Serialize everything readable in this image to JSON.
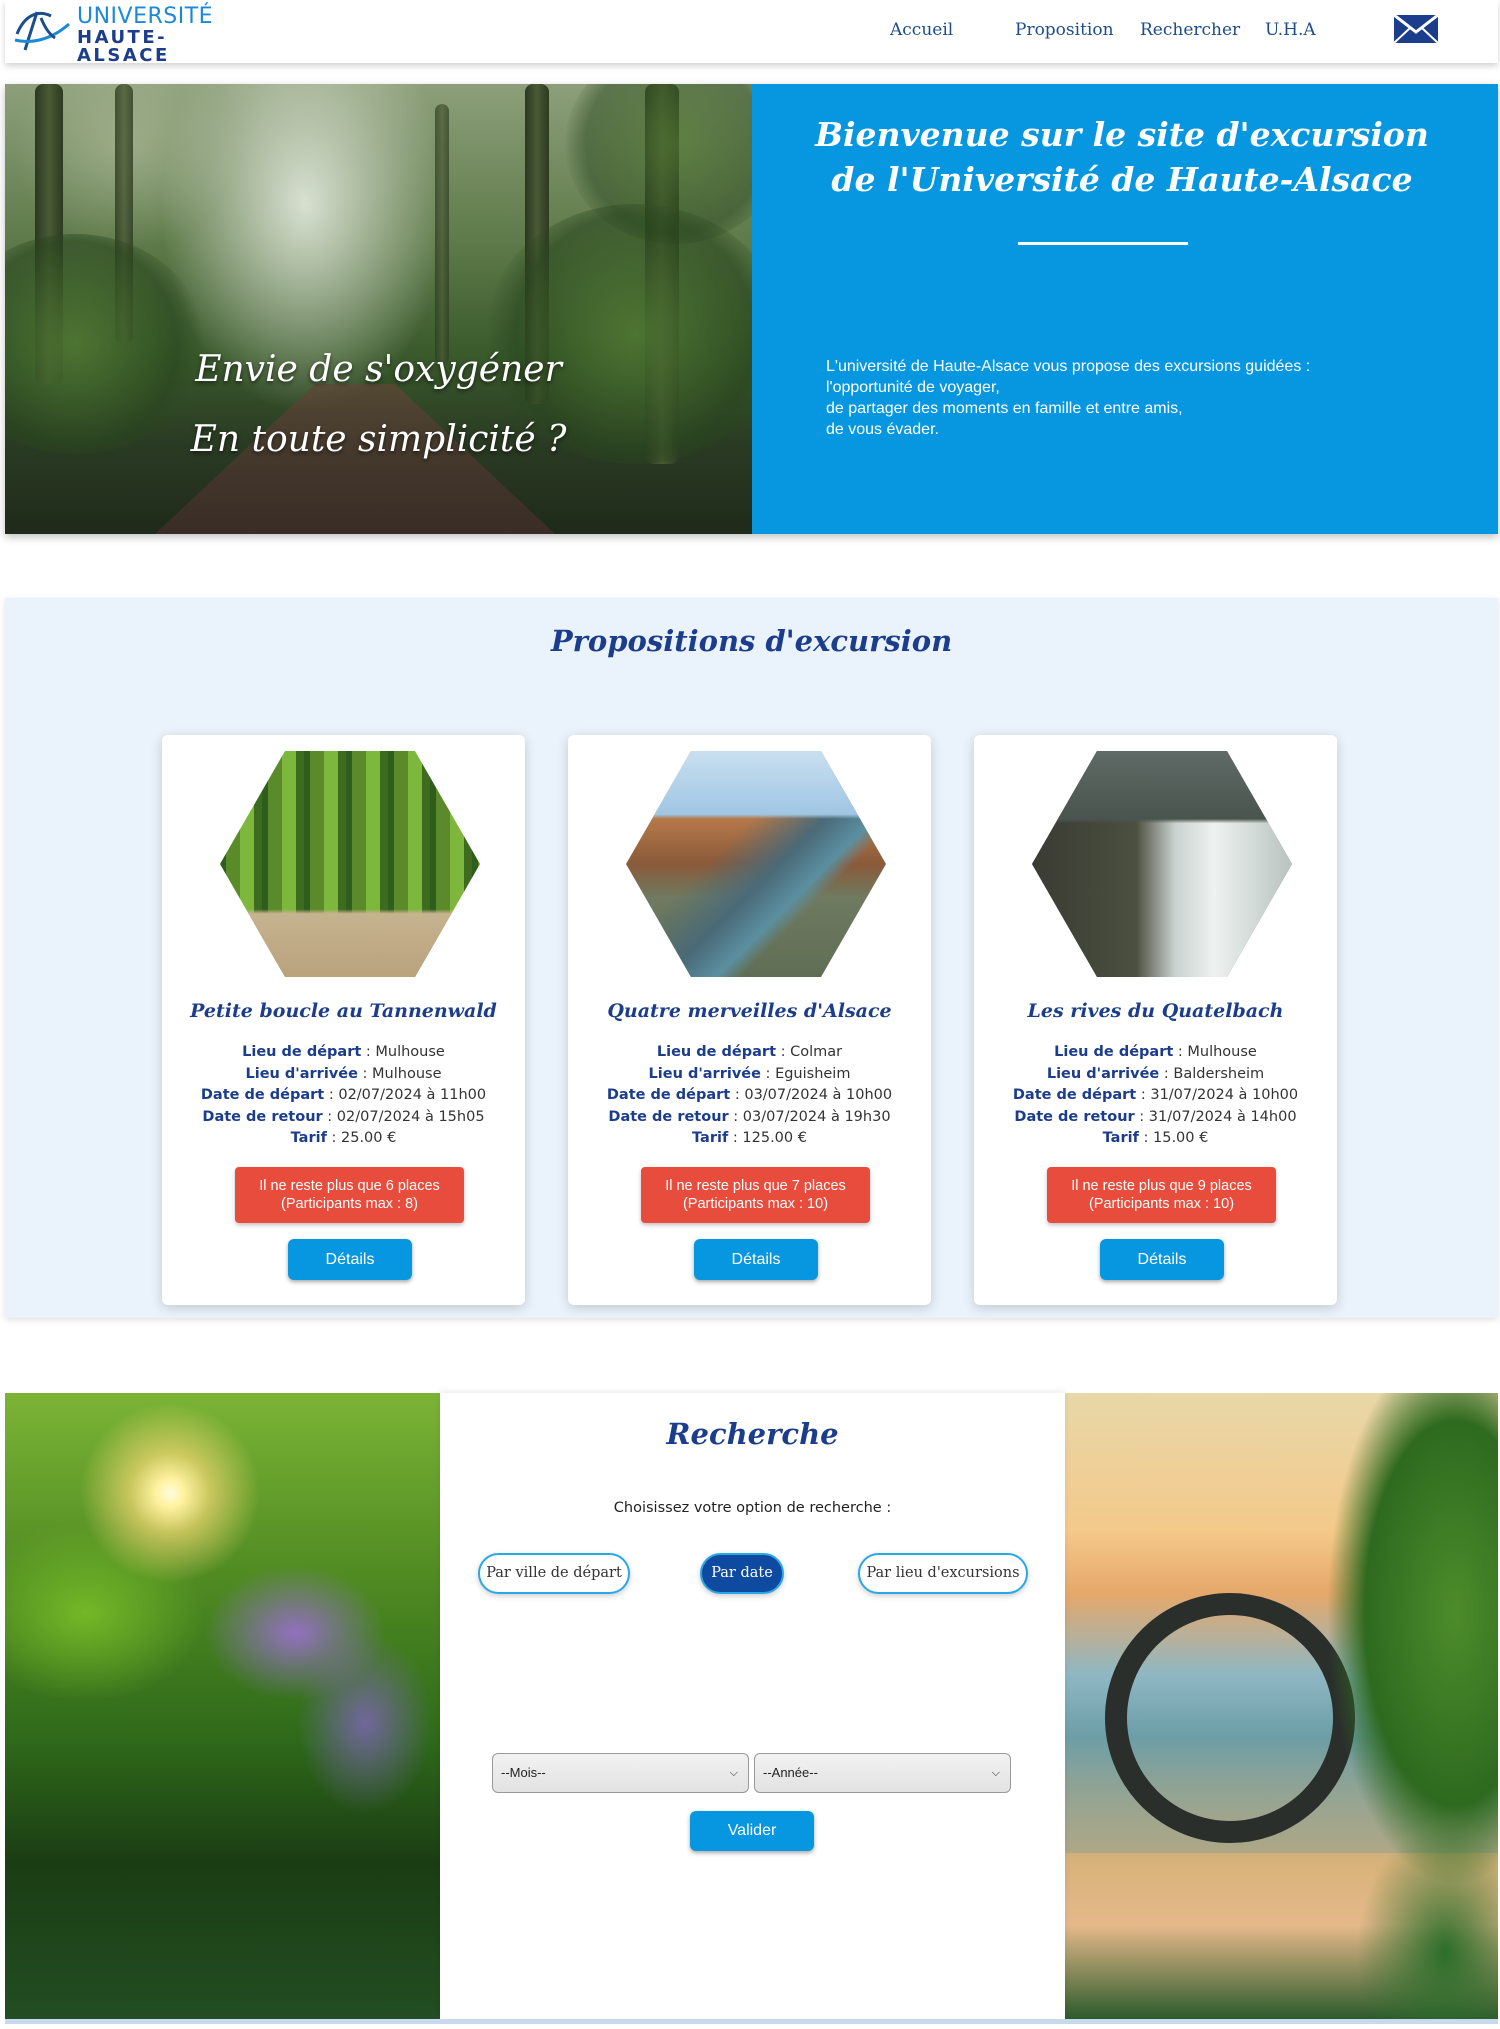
{
  "nav": {
    "logo_line1": "UNIVERSITÉ",
    "logo_line2": "HAUTE-ALSACE",
    "links": [
      "Accueil",
      "Proposition",
      "Rechercher",
      "U.H.A"
    ]
  },
  "hero": {
    "quote_line1": "Envie de s'oxygéner",
    "quote_line2": "En toute simplicité ?",
    "title": "Bienvenue sur le site d'excursion de l'Université de Haute-Alsace",
    "description": [
      "L'université de Haute-Alsace vous propose des excursions guidées :",
      "l'opportunité de voyager,",
      "de partager des moments en famille et entre amis,",
      "de vous évader."
    ]
  },
  "propositions": {
    "title": "Propositions d'excursion",
    "labels": {
      "depart": "Lieu de départ",
      "arrivee": "Lieu d'arrivée",
      "date_depart": "Date de départ",
      "date_retour": "Date de retour",
      "tarif": "Tarif"
    },
    "details_label": "Détails",
    "cards": [
      {
        "title": "Petite boucle au Tannenwald",
        "depart": "Mulhouse",
        "arrivee": "Mulhouse",
        "date_depart": "02/07/2024 à 11h00",
        "date_retour": "02/07/2024 à 15h05",
        "tarif": "25.00 €",
        "places_line1": "Il ne reste plus que 6 places",
        "places_line2": "(Participants max : 8)"
      },
      {
        "title": "Quatre merveilles d'Alsace",
        "depart": "Colmar",
        "arrivee": "Eguisheim",
        "date_depart": "03/07/2024 à 10h00",
        "date_retour": "03/07/2024 à 19h30",
        "tarif": "125.00 €",
        "places_line1": "Il ne reste plus que 7 places",
        "places_line2": "(Participants max : 10)"
      },
      {
        "title": "Les rives du Quatelbach",
        "depart": "Mulhouse",
        "arrivee": "Baldersheim",
        "date_depart": "31/07/2024 à 10h00",
        "date_retour": "31/07/2024 à 14h00",
        "tarif": "15.00 €",
        "places_line1": "Il ne reste plus que 9 places",
        "places_line2": "(Participants max : 10)"
      }
    ]
  },
  "search": {
    "title": "Recherche",
    "prompt": "Choisissez votre option de recherche :",
    "options": [
      "Par ville de départ",
      "Par date",
      "Par lieu d'excursions"
    ],
    "active_option": "Par date",
    "month_select": "--Mois--",
    "year_select": "--Année--",
    "submit_label": "Valider"
  },
  "colors": {
    "primary_blue": "#0797e0",
    "dark_blue": "#1c3d8c",
    "alert_red": "#e74c3c",
    "section_bg": "#eaf3fc"
  },
  "icons": {
    "logo": "uha-logo-icon",
    "mail": "mail-icon",
    "chevron": "chevron-down-icon"
  }
}
